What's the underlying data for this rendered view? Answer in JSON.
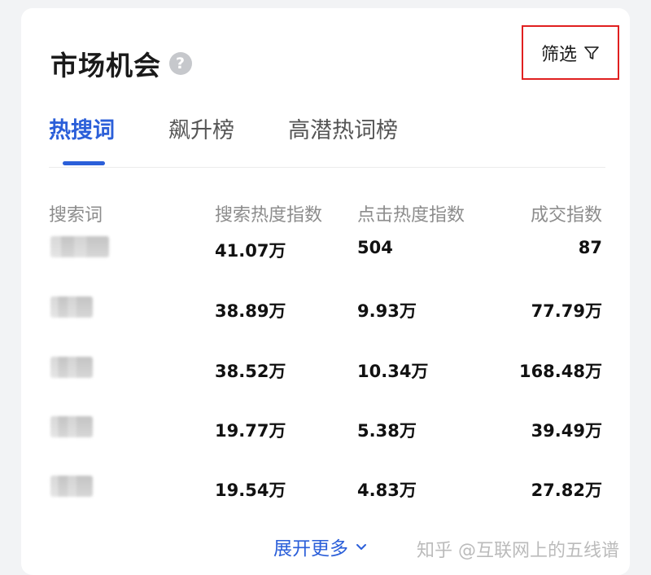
{
  "header": {
    "title": "市场机会",
    "help_icon": "?",
    "filter_label": "筛选"
  },
  "tabs": [
    {
      "label": "热搜词",
      "active": true
    },
    {
      "label": "飙升榜",
      "active": false
    },
    {
      "label": "高潜热词榜",
      "active": false
    }
  ],
  "table": {
    "columns": [
      "搜索词",
      "搜索热度指数",
      "点击热度指数",
      "成交指数"
    ],
    "rows": [
      {
        "search_heat": "41.07万",
        "click_heat": "504",
        "deal_index": "87"
      },
      {
        "search_heat": "38.89万",
        "click_heat": "9.93万",
        "deal_index": "77.79万"
      },
      {
        "search_heat": "38.52万",
        "click_heat": "10.34万",
        "deal_index": "168.48万"
      },
      {
        "search_heat": "19.77万",
        "click_heat": "5.38万",
        "deal_index": "39.49万"
      },
      {
        "search_heat": "19.54万",
        "click_heat": "4.83万",
        "deal_index": "27.82万"
      }
    ]
  },
  "more_label": "展开更多",
  "watermark": "知乎 @互联网上的五线谱",
  "colors": {
    "accent": "#2b5fd9",
    "highlight_border": "#e02020"
  }
}
